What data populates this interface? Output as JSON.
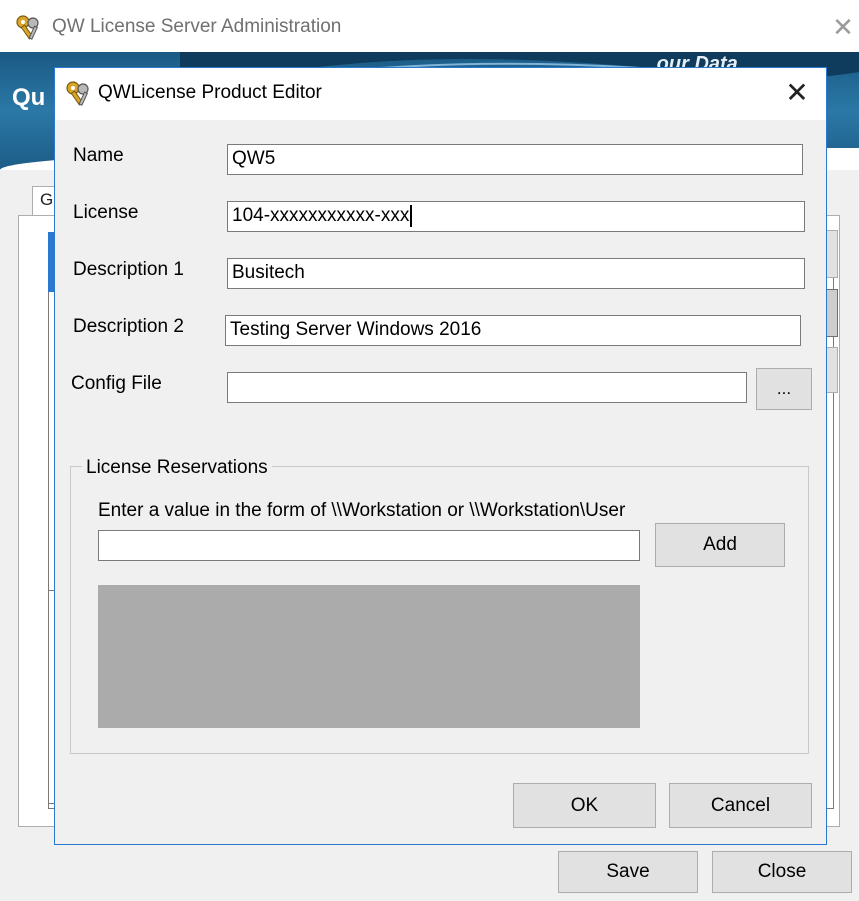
{
  "parent_window": {
    "title": "QW License Server Administration",
    "close_glyph": "✕",
    "icon": "keys-icon",
    "banner": {
      "logo_text": "Qu",
      "tagline": "...our Data"
    },
    "tab_label": "G",
    "buttons": {
      "save_label": "Save",
      "close_label": "Close"
    }
  },
  "dialog": {
    "title": "QWLicense Product Editor",
    "close_glyph": "✕",
    "icon": "keys-icon",
    "fields": {
      "name": {
        "label": "Name",
        "value": "QW5"
      },
      "license": {
        "label": "License",
        "value": "104-xxxxxxxxxxx-xxx"
      },
      "description1": {
        "label": "Description 1",
        "value": "Busitech"
      },
      "description2": {
        "label": "Description 2",
        "value": "Testing Server Windows 2016"
      },
      "config_file": {
        "label": "Config File",
        "value": "",
        "browse_label": "..."
      }
    },
    "reservations": {
      "group_label": "License Reservations",
      "hint": "Enter a value in the form of \\\\Workstation or \\\\Workstation\\User",
      "input_value": "",
      "add_label": "Add",
      "items": []
    },
    "buttons": {
      "ok_label": "OK",
      "cancel_label": "Cancel"
    }
  },
  "colors": {
    "accent": "#2b78d0",
    "banner": "#1a5a84",
    "list_bg": "#ababab"
  }
}
